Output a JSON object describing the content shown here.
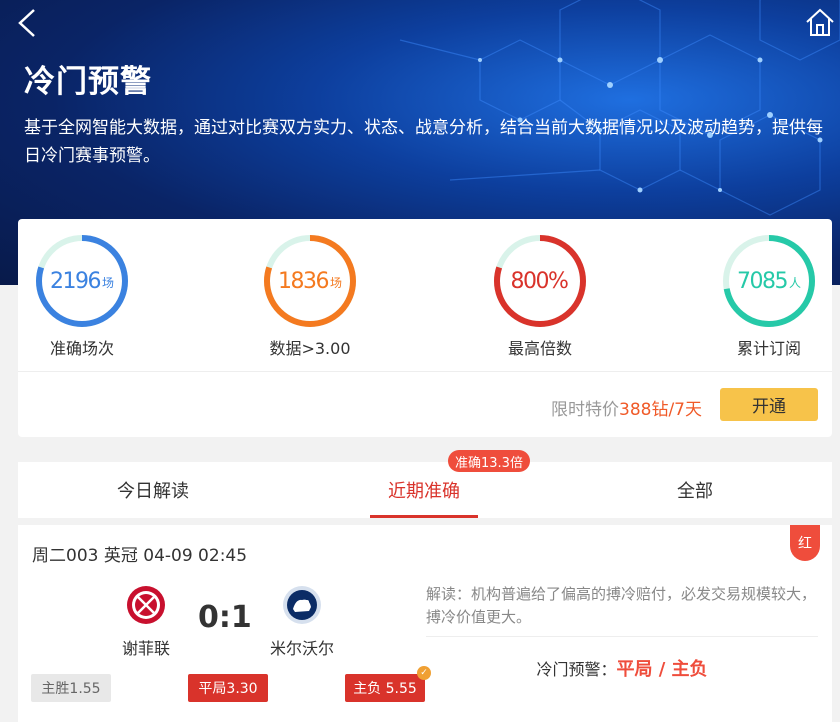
{
  "header": {
    "title": "冷门预警",
    "description": "基于全网智能大数据，通过对比赛双方实力、状态、战意分析，结合当前大数据情况以及波动趋势，提供每日冷门赛事预警。"
  },
  "stats": [
    {
      "value": "2196",
      "unit": "场",
      "label": "准确场次",
      "color": "#3b82e0",
      "fill": 0.8
    },
    {
      "value": "1836",
      "unit": "场",
      "label": "数据>3.00",
      "color": "#f47a20",
      "fill": 0.8
    },
    {
      "value": "800%",
      "unit": "",
      "label": "最高倍数",
      "color": "#d9332b",
      "fill": 0.8
    },
    {
      "value": "7085",
      "unit": "人",
      "label": "累计订阅",
      "color": "#26c9a8",
      "fill": 0.72
    }
  ],
  "subscribe": {
    "price_prefix": "限时特价",
    "price_value": "388钻/7天",
    "button": "开通"
  },
  "tabs": {
    "items": [
      "今日解读",
      "近期准确",
      "全部"
    ],
    "active_index": 1,
    "badge": "准确13.3倍"
  },
  "match": {
    "header": "周二003 英冠 04-09 02:45",
    "result_tag": "红",
    "home_team": "谢菲联",
    "away_team": "米尔沃尔",
    "score": "0:1",
    "analysis": "解读：机构普遍给了偏高的搏冷赔付，必发交易规模较大，搏冷价值更大。",
    "warning_label": "冷门预警：",
    "warning_pick": "平局 / 主负",
    "odds": [
      {
        "label": "主胜1.55",
        "style": "grey"
      },
      {
        "label": "平局3.30",
        "style": "red"
      },
      {
        "label": "主负 5.55",
        "style": "red",
        "checked": true
      }
    ]
  }
}
